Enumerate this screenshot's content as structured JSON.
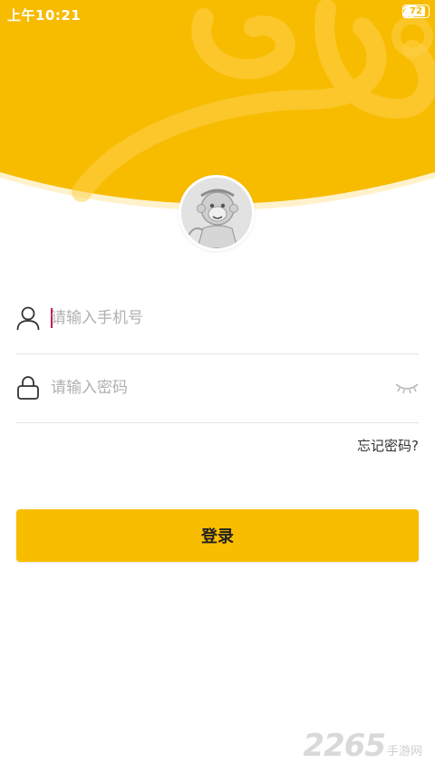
{
  "status_bar": {
    "time": "上午10:21",
    "battery": "72",
    "icons": [
      "mute-icon",
      "alarm-icon",
      "signal-icon",
      "wifi-icon",
      "battery-icon"
    ]
  },
  "colors": {
    "brand": "#f9bd00",
    "header": "#f7bb00",
    "caret": "#c2185b"
  },
  "login_form": {
    "phone_placeholder": "请输入手机号",
    "password_placeholder": "请输入密码",
    "forgot_password": "忘记密码?",
    "login_button": "登录"
  },
  "watermark": {
    "number": "2265",
    "text": "手游网"
  }
}
